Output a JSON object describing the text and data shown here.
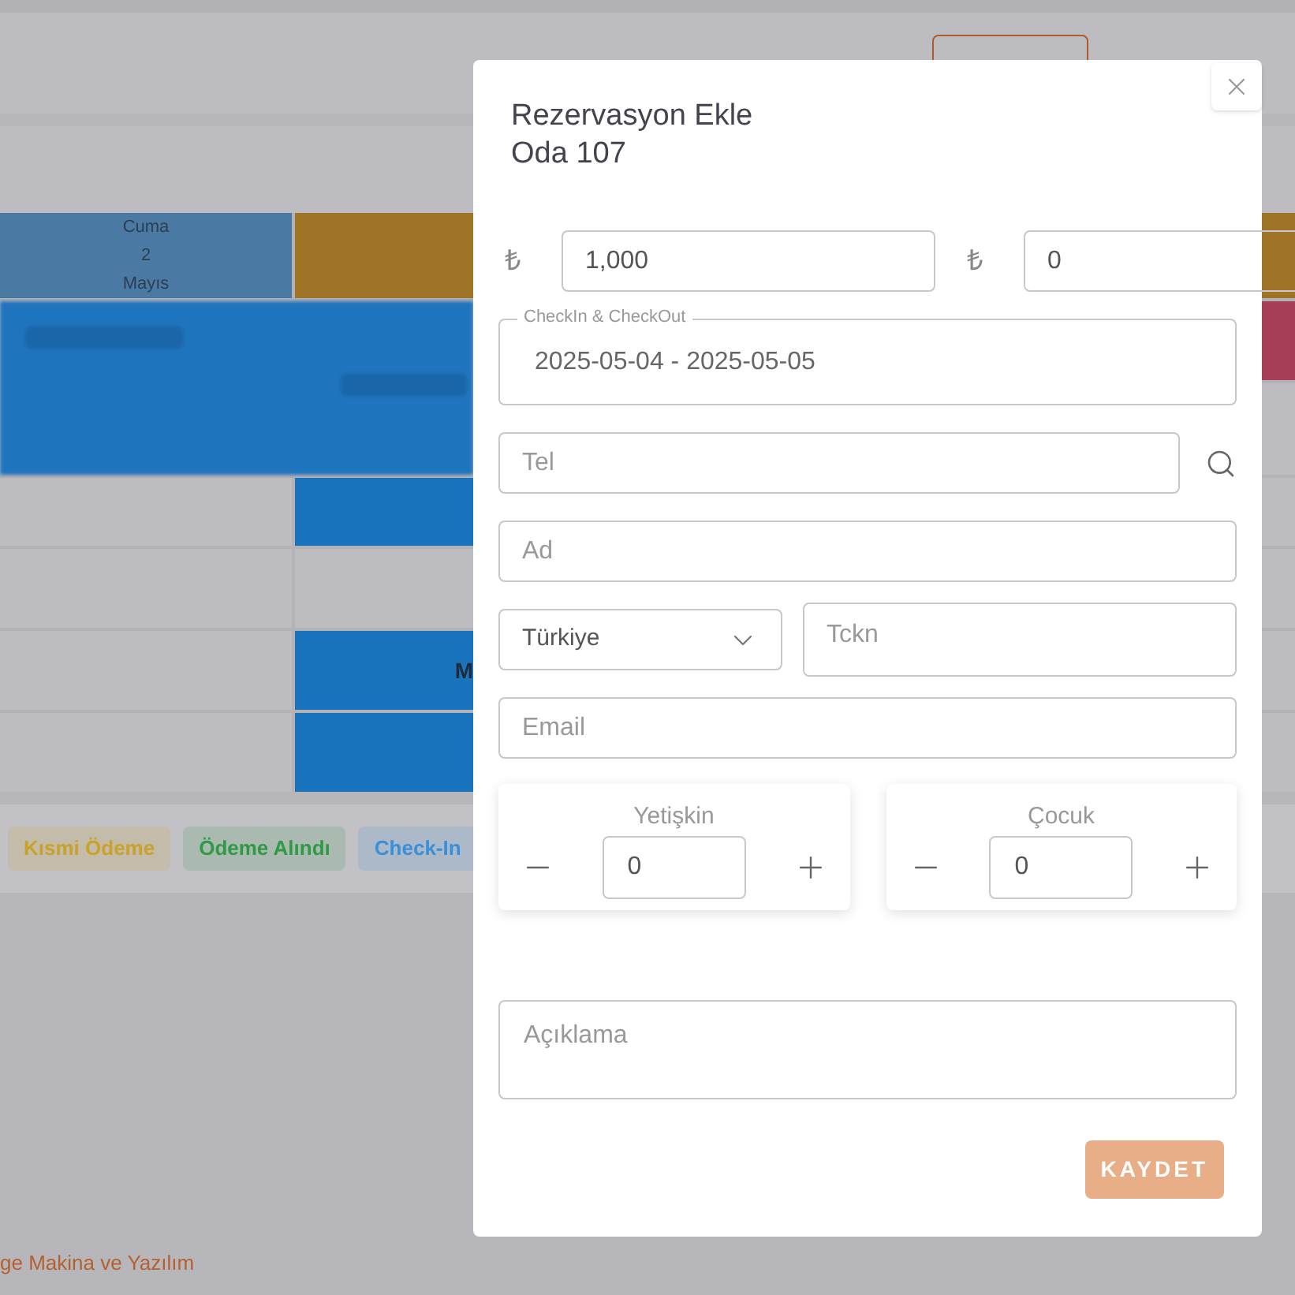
{
  "schedule": {
    "day_header": {
      "day": "Cuma",
      "date": "2",
      "month": "Mayıs"
    },
    "cell_text": "M"
  },
  "legend": [
    {
      "label": "Kısmi Ödeme",
      "color": "#c9a227"
    },
    {
      "label": "Ödeme Alındı",
      "color": "#2f9a46"
    },
    {
      "label": "Check-In",
      "color": "#3a8fd9"
    }
  ],
  "footer": "ge Makina ve Yazılım",
  "modal": {
    "title": "Rezervasyon Ekle",
    "subtitle": "Oda 107",
    "prices": [
      {
        "currency": "₺",
        "value": "1,000"
      },
      {
        "currency": "₺",
        "value": "0"
      }
    ],
    "dates": {
      "label": "CheckIn & CheckOut",
      "value": "2025-05-04 - 2025-05-05"
    },
    "phone": {
      "placeholder": "Tel"
    },
    "name": {
      "placeholder": "Ad"
    },
    "country": {
      "value": "Türkiye"
    },
    "tckn": {
      "placeholder": "Tckn"
    },
    "email": {
      "placeholder": "Email"
    },
    "counters": [
      {
        "label": "Yetişkin",
        "value": "0"
      },
      {
        "label": "Çocuk",
        "value": "0"
      }
    ],
    "note": {
      "placeholder": "Açıklama"
    },
    "save": "KAYDET"
  }
}
